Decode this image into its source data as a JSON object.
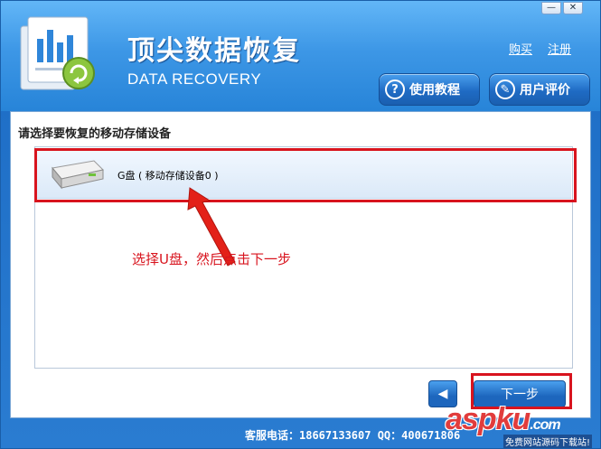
{
  "window": {
    "title": "顶尖数据恢复",
    "subtitle": "DATA RECOVERY",
    "minimize": "—",
    "close": "✕"
  },
  "header": {
    "buy": "购买",
    "register": "注册",
    "tutorial": "使用教程",
    "review": "用户评价"
  },
  "main": {
    "prompt": "请选择要恢复的移动存储设备",
    "devices": [
      {
        "label": "G盘 ( 移动存储设备0 )"
      }
    ],
    "annotation": "选择U盘，然后点击下一步"
  },
  "footer": {
    "next": "下一步",
    "back_icon": "◀",
    "support": "客服电话：18667133607  QQ：400671806"
  },
  "watermark": {
    "brand": "aspku",
    "brand_suffix": ".com",
    "tagline": "免费网站源码下载站!"
  },
  "colors": {
    "accent": "#2a7cd1",
    "highlight": "#d8141e"
  }
}
